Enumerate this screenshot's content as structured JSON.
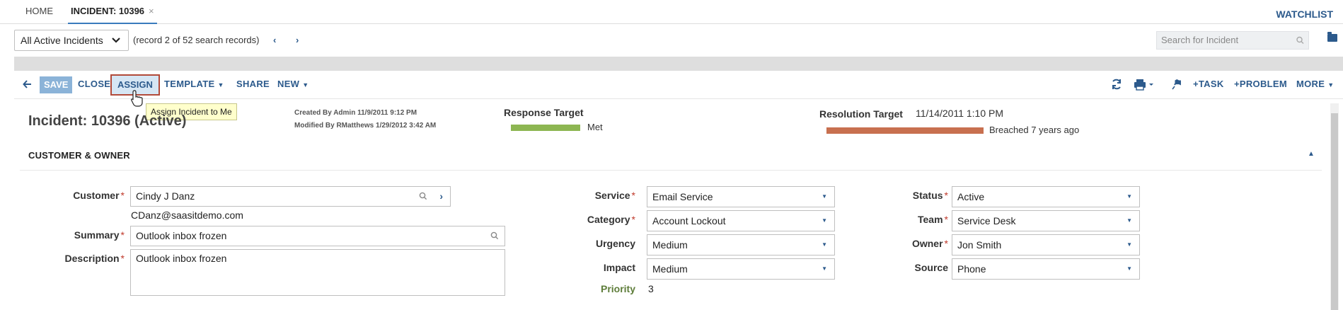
{
  "tabs": [
    {
      "label": "HOME"
    },
    {
      "label": "INCIDENT: 10396",
      "close": "×"
    }
  ],
  "watchlist": "WATCHLIST",
  "search_bar": {
    "filter_value": "All Active Incidents",
    "record_text": "(record 2 of 52 search records)",
    "search_placeholder": "Search for Incident"
  },
  "toolbar": {
    "save": "SAVE",
    "close": "CLOSE",
    "assign": "ASSIGN",
    "template": "TEMPLATE",
    "share": "SHARE",
    "new": "NEW",
    "task": "+TASK",
    "problem": "+PROBLEM",
    "more": "MORE"
  },
  "tooltip": "Assign Incident to Me",
  "header": {
    "title": "Incident: 10396 (Active)",
    "created": "Created By Admin 11/9/2011 9:12 PM",
    "modified": "Modified By RMatthews 1/29/2012 3:42 AM",
    "response_label": "Response Target",
    "response_status": "Met",
    "resolution_label": "Resolution Target",
    "resolution_date": "11/14/2011 1:10 PM",
    "resolution_status": "Breached 7 years ago"
  },
  "colors": {
    "met": "#8db652",
    "breached": "#c8704f",
    "accent": "#2c5a8c"
  },
  "section": {
    "title": "CUSTOMER & OWNER"
  },
  "form": {
    "customer_label": "Customer",
    "customer_value": "Cindy J Danz",
    "customer_email": "CDanz@saasitdemo.com",
    "summary_label": "Summary",
    "summary_value": "Outlook inbox frozen",
    "description_label": "Description",
    "description_value": "Outlook inbox frozen",
    "service_label": "Service",
    "service_value": "Email Service",
    "category_label": "Category",
    "category_value": "Account Lockout",
    "urgency_label": "Urgency",
    "urgency_value": "Medium",
    "impact_label": "Impact",
    "impact_value": "Medium",
    "priority_label": "Priority",
    "priority_value": "3",
    "status_label": "Status",
    "status_value": "Active",
    "team_label": "Team",
    "team_value": "Service Desk",
    "owner_label": "Owner",
    "owner_value": "Jon Smith",
    "source_label": "Source",
    "source_value": "Phone",
    "required_mark": "*"
  }
}
